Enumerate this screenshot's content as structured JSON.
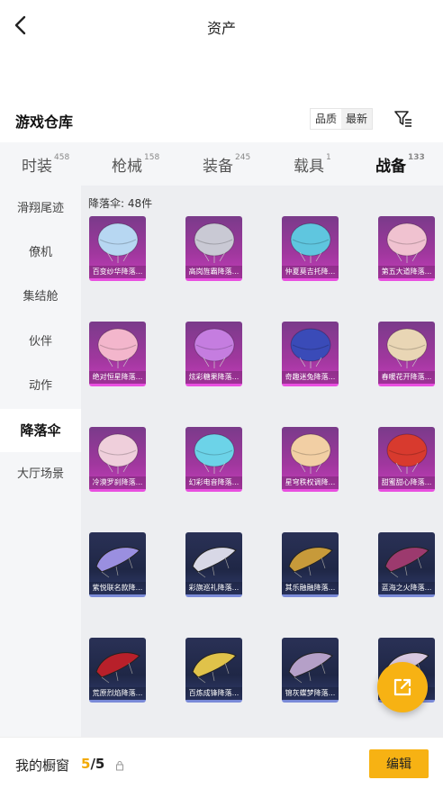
{
  "header": {
    "title": "资产"
  },
  "section": {
    "title": "游戏仓库",
    "sort_options": [
      "品质",
      "最新"
    ],
    "active_sort": "最新"
  },
  "tabs": [
    {
      "label": "时装",
      "count": "458",
      "active": false
    },
    {
      "label": "枪械",
      "count": "158",
      "active": false
    },
    {
      "label": "装备",
      "count": "245",
      "active": false
    },
    {
      "label": "载具",
      "count": "1",
      "active": false
    },
    {
      "label": "战备",
      "count": "133",
      "active": true
    }
  ],
  "sidebar": {
    "items": [
      {
        "label": "滑翔尾迹"
      },
      {
        "label": "僚机"
      },
      {
        "label": "集结舱"
      },
      {
        "label": "伙伴"
      },
      {
        "label": "动作"
      },
      {
        "label": "降落伞",
        "active": true
      },
      {
        "label": "大厅场景"
      }
    ]
  },
  "grid": {
    "count_label": "降落伞: 48件",
    "items": [
      {
        "name": "百变纱华降落...",
        "color": "#b7d7f2",
        "style": "purple"
      },
      {
        "name": "高岗旌霸降落...",
        "color": "#c9c9d4",
        "style": "purple"
      },
      {
        "name": "仲夏莫吉托降...",
        "color": "#5fc6df",
        "style": "purple"
      },
      {
        "name": "第五大道降落...",
        "color": "#f0c2d0",
        "style": "purple"
      },
      {
        "name": "绝对恒星降落...",
        "color": "#f3b6cc",
        "style": "purple"
      },
      {
        "name": "炫彩糖果降落...",
        "color": "#c57de0",
        "style": "purple"
      },
      {
        "name": "奇趣迷兔降落...",
        "color": "#3a4bb8",
        "style": "purple"
      },
      {
        "name": "春暖花开降落...",
        "color": "#e9d6b5",
        "style": "purple"
      },
      {
        "name": "冷漠罗刹降落...",
        "color": "#efcfdb",
        "style": "purple"
      },
      {
        "name": "幻彩电音降落...",
        "color": "#6cd3e8",
        "style": "purple"
      },
      {
        "name": "星穹秩权调降...",
        "color": "#f2cfa4",
        "style": "purple"
      },
      {
        "name": "甜蜜甜心降落...",
        "color": "#d83a2e",
        "style": "purple"
      },
      {
        "name": "紫悦联名款降...",
        "color": "#9a8fe0",
        "style": "blue"
      },
      {
        "name": "彩旗巡礼降落...",
        "color": "#d8d8e6",
        "style": "blue"
      },
      {
        "name": "其乐融融降落...",
        "color": "#c79a3a",
        "style": "blue"
      },
      {
        "name": "蓝海之火降落...",
        "color": "#9c3a6e",
        "style": "blue"
      },
      {
        "name": "荒原烈焰降落...",
        "color": "#b8202a",
        "style": "blue"
      },
      {
        "name": "百炼成锋降落...",
        "color": "#e0c24a",
        "style": "blue"
      },
      {
        "name": "锦灰蝶梦降落...",
        "color": "#b5a0c8",
        "style": "blue"
      },
      {
        "name": "",
        "color": "#d8c8e0",
        "style": "blue"
      }
    ]
  },
  "footer": {
    "label": "我的橱窗",
    "current": "5",
    "total": "/5",
    "edit_label": "编辑"
  },
  "colors": {
    "accent": "#f7b213"
  }
}
